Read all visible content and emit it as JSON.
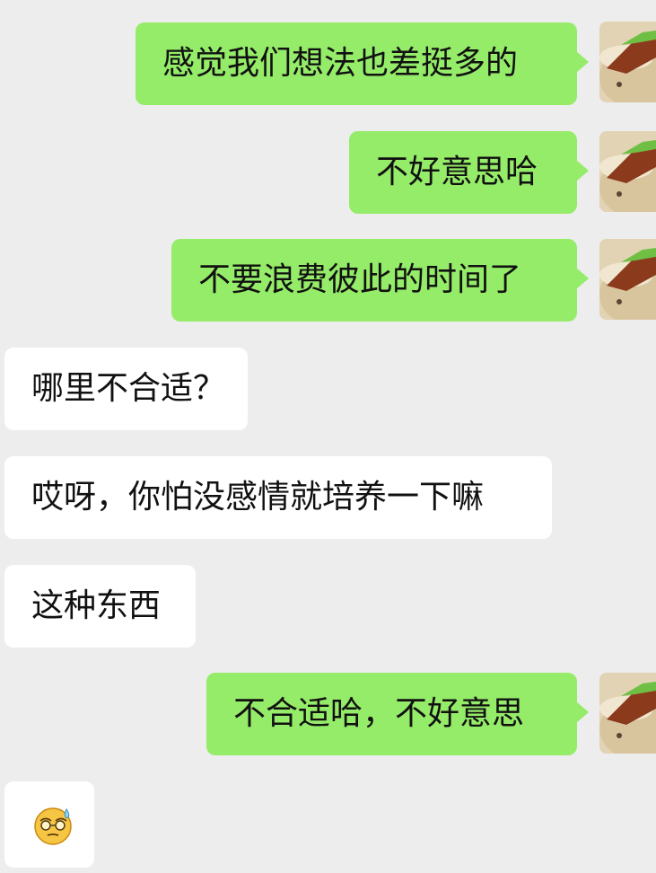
{
  "colors": {
    "background": "#ededed",
    "outgoing_bubble": "#95ec69",
    "incoming_bubble": "#ffffff",
    "text": "#111111"
  },
  "messages": [
    {
      "direction": "outgoing",
      "text": "感觉我们想法也差挺多的"
    },
    {
      "direction": "outgoing",
      "text": "不好意思哈"
    },
    {
      "direction": "outgoing",
      "text": "不要浪费彼此的时间了"
    },
    {
      "direction": "incoming",
      "text": "哪里不合适？"
    },
    {
      "direction": "incoming",
      "text": "哎呀，你怕没感情就培养一下嘛"
    },
    {
      "direction": "incoming",
      "text": "这种东西"
    },
    {
      "direction": "outgoing",
      "text": "不合适哈，不好意思"
    },
    {
      "direction": "incoming",
      "emoji": "sweating-face-with-glasses-emoji"
    }
  ]
}
